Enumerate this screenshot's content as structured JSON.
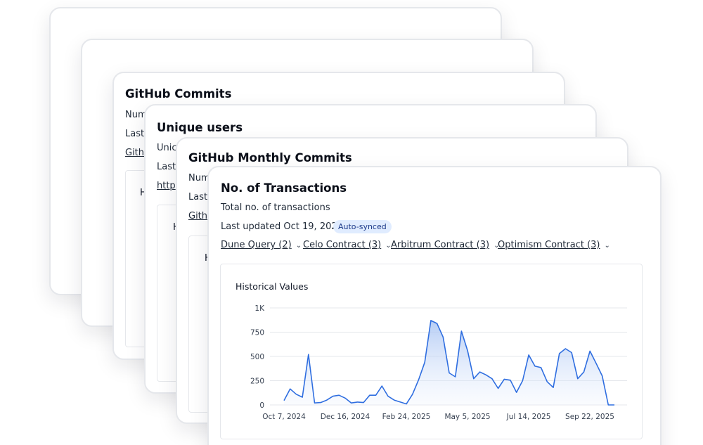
{
  "cards": {
    "github_commits": {
      "title": "GitHub Commits",
      "line1": "Num",
      "line2": "Last",
      "link": "Githu",
      "box_label": "H"
    },
    "unique_users": {
      "title": "Unique users",
      "line1": "Unic",
      "line2": "Last",
      "link": "http",
      "box_label": "H"
    },
    "github_monthly_commits": {
      "title": "GitHub Monthly Commits",
      "line1": "Num",
      "line2": "Last",
      "link": "Githu",
      "box_label": "H"
    },
    "transactions": {
      "title": "No. of Transactions",
      "description": "Total no. of transactions",
      "last_updated": "Last updated Oct 19, 2025",
      "badge": "Auto-synced",
      "sources": [
        {
          "label": "Dune Query (2)"
        },
        {
          "label": "Celo Contract (3)"
        },
        {
          "label": "Arbitrum Contract (3)"
        },
        {
          "label": "Optimism Contract (3)"
        }
      ],
      "chart_title": "Historical Values"
    }
  },
  "icons": {
    "chevron": "chevron-down-icon",
    "chevron_glyph": "⌄"
  },
  "colors": {
    "line": "#2f6ee0",
    "area_top": "#a9c4f3",
    "grid": "#e5e7eb",
    "badge_bg": "#e0ecff",
    "badge_text": "#1d3a8a"
  },
  "chart_data": {
    "type": "area",
    "title": "Historical Values",
    "xlabel": "",
    "ylabel": "",
    "ylim": [
      0,
      1000
    ],
    "yticks": [
      0,
      250,
      500,
      750,
      1000
    ],
    "ytick_labels": [
      "0",
      "250",
      "500",
      "750",
      "1K"
    ],
    "xticks": [
      "Oct 7, 2024",
      "Dec 16, 2024",
      "Feb 24, 2025",
      "May 5, 2025",
      "Jul 14, 2025",
      "Sep 22, 2025"
    ],
    "grid": true,
    "values": [
      45,
      165,
      110,
      80,
      520,
      20,
      25,
      50,
      90,
      100,
      70,
      20,
      30,
      25,
      100,
      100,
      195,
      90,
      50,
      30,
      10,
      110,
      260,
      440,
      870,
      840,
      700,
      330,
      290,
      760,
      560,
      270,
      340,
      310,
      270,
      170,
      265,
      255,
      130,
      250,
      515,
      400,
      385,
      240,
      180,
      530,
      580,
      540,
      270,
      340,
      555,
      430,
      300,
      0,
      0
    ]
  }
}
